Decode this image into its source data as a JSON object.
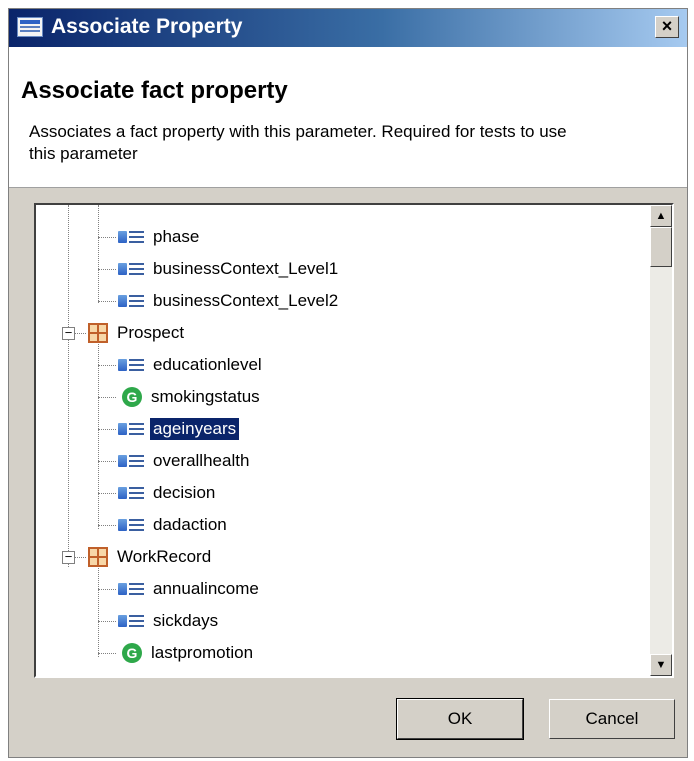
{
  "window": {
    "title": "Associate Property",
    "close_glyph": "×"
  },
  "banner": {
    "heading": "Associate fact property",
    "description": "Associates a fact property with this parameter.  Required for tests to use this parameter"
  },
  "tree": {
    "items": [
      {
        "label": "phase",
        "icon": "field-icon"
      },
      {
        "label": "businessContext_Level1",
        "icon": "field-icon"
      },
      {
        "label": "businessContext_Level2",
        "icon": "field-icon"
      },
      {
        "label": "Prospect",
        "icon": "class-icon",
        "expanded": true
      },
      {
        "label": "educationlevel",
        "icon": "field-icon"
      },
      {
        "label": "smokingstatus",
        "icon": "method-icon"
      },
      {
        "label": "ageinyears",
        "icon": "field-icon",
        "selected": true
      },
      {
        "label": "overallhealth",
        "icon": "field-icon"
      },
      {
        "label": "decision",
        "icon": "field-icon"
      },
      {
        "label": "dadaction",
        "icon": "field-icon"
      },
      {
        "label": "WorkRecord",
        "icon": "class-icon",
        "expanded": true
      },
      {
        "label": "annualincome",
        "icon": "field-icon"
      },
      {
        "label": "sickdays",
        "icon": "field-icon"
      },
      {
        "label": "lastpromotion",
        "icon": "method-icon"
      }
    ],
    "method_icon_glyph": "G",
    "expander_glyph": "−"
  },
  "scrollbar": {
    "up_glyph": "▲",
    "down_glyph": "▼"
  },
  "buttons": {
    "ok_label": "OK",
    "cancel_label": "Cancel"
  }
}
